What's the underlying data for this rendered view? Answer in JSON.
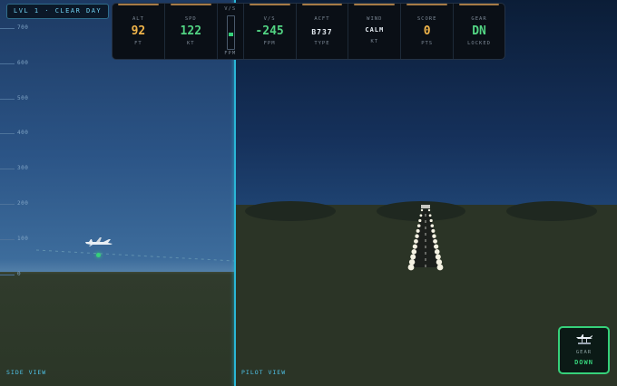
{
  "level_badge": "LVL 1 · CLEAR DAY",
  "hud": {
    "alt": {
      "label": "ALT",
      "value": "92",
      "unit": "FT",
      "color": "#f0b44a"
    },
    "spd": {
      "label": "SPD",
      "value": "122",
      "unit": "KT",
      "color": "#52d483"
    },
    "vsmeter": {
      "label": "V/S",
      "unit": "FPM",
      "level": 0.42
    },
    "vs": {
      "label": "V/S",
      "value": "-245",
      "unit": "FPM",
      "color": "#52d483"
    },
    "acft": {
      "label": "ACFT",
      "value": "B737",
      "unit": "TYPE"
    },
    "wind": {
      "label": "WIND",
      "value": "CALM",
      "unit": "KT"
    },
    "score": {
      "label": "SCORE",
      "value": "0",
      "unit": "PTS",
      "color": "#f0b44a"
    },
    "gear": {
      "label": "GEAR",
      "value": "DN",
      "unit": "LOCKED",
      "color": "#52d483"
    }
  },
  "side_view": {
    "label": "SIDE VIEW",
    "altitude_ticks": [
      "700",
      "600",
      "500",
      "400",
      "300",
      "200",
      "100",
      "0"
    ]
  },
  "pilot_view": {
    "label": "PILOT VIEW"
  },
  "gear_button": {
    "label": "GEAR",
    "state": "DOWN",
    "icon": "landing-gear-icon"
  }
}
